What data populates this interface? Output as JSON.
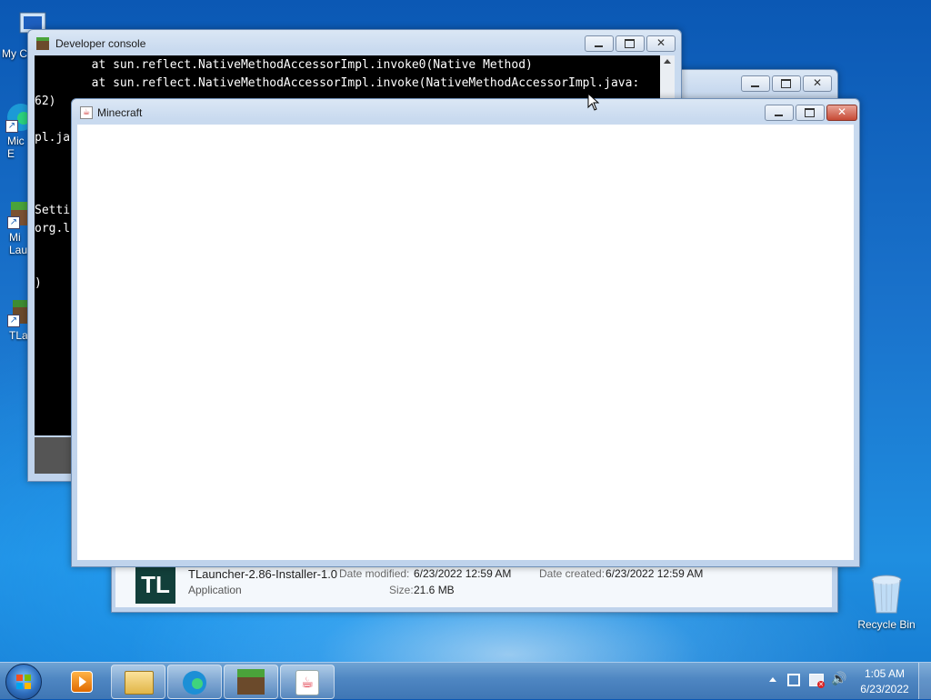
{
  "desktop": {
    "icons": [
      {
        "label": "My C"
      },
      {
        "label": "Mic\nE"
      },
      {
        "label": "Mi\nLau"
      },
      {
        "label": "TLa"
      },
      {
        "label": "Recycle Bin"
      }
    ]
  },
  "console_window": {
    "title": "Developer console",
    "lines": [
      "        at sun.reflect.NativeMethodAccessorImpl.invoke0(Native Method)",
      "        at sun.reflect.NativeMethodAccessorImpl.invoke(NativeMethodAccessorImpl.java:",
      "62)",
      "pl.ja",
      "Setti",
      "org.l",
      ")"
    ]
  },
  "explorer_window": {
    "file_name": "TLauncher-2.86-Installer-1.0",
    "file_type": "Application",
    "date_modified_label": "Date modified:",
    "date_modified": "6/23/2022 12:59 AM",
    "date_created_label": "Date created:",
    "date_created": "6/23/2022 12:59 AM",
    "size_label": "Size:",
    "size": "21.6 MB"
  },
  "minecraft_window": {
    "title": "Minecraft"
  },
  "taskbar": {
    "apps": [
      "media-player-icon",
      "file-explorer-icon",
      "edge-icon",
      "minecraft-icon",
      "java-icon"
    ],
    "clock_time": "1:05 AM",
    "clock_date": "6/23/2022"
  },
  "colors": {
    "accent": "#1a73cc",
    "titlebar": "#c9daef",
    "close": "#c64a35"
  }
}
